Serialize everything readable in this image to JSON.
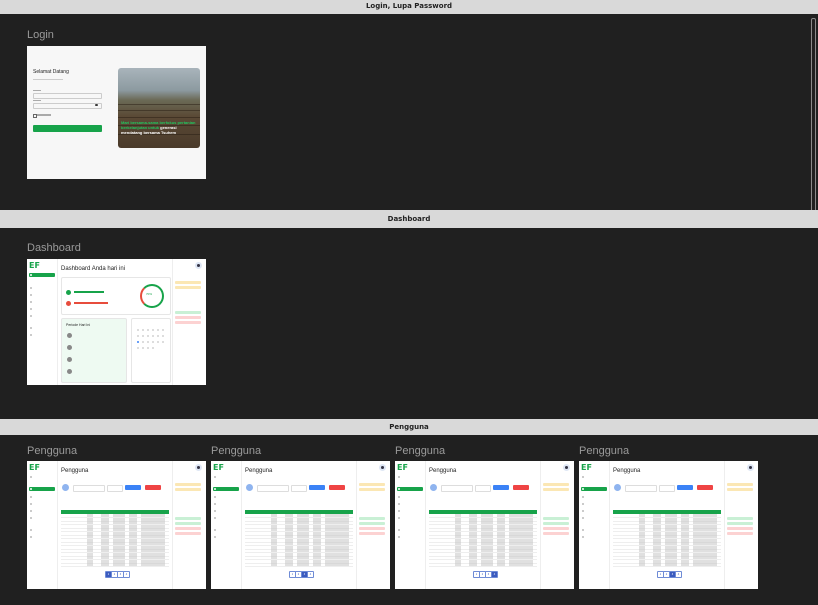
{
  "sections": {
    "login": {
      "band": "Login, Lupa Password",
      "frame_label": "Login"
    },
    "dashboard": {
      "band": "Dashboard",
      "frame_label": "Dashboard"
    },
    "pengguna": {
      "band": "Pengguna",
      "frame_label": "Pengguna"
    }
  },
  "login_screen": {
    "title": "Selamat Datang",
    "caption_green": "Mari bersama-sama berfokus pertanian berkelanjutan untuk",
    "caption_white": "generasi mendatang bersama Tsuhem"
  },
  "dashboard_screen": {
    "heading": "Dashboard Anda hari ini",
    "ring_value": "70%",
    "section_title": "Periode Hari Ini"
  },
  "pengguna_screen": {
    "heading": "Pengguna",
    "pages": [
      "1",
      "2",
      "3",
      "4"
    ]
  },
  "colors": {
    "accent": "#17a34a",
    "background": "#1e1e1e",
    "band": "#d9d9d9"
  },
  "icons": [
    "avatar-icon",
    "logo-icon",
    "search-icon",
    "eye-icon"
  ]
}
